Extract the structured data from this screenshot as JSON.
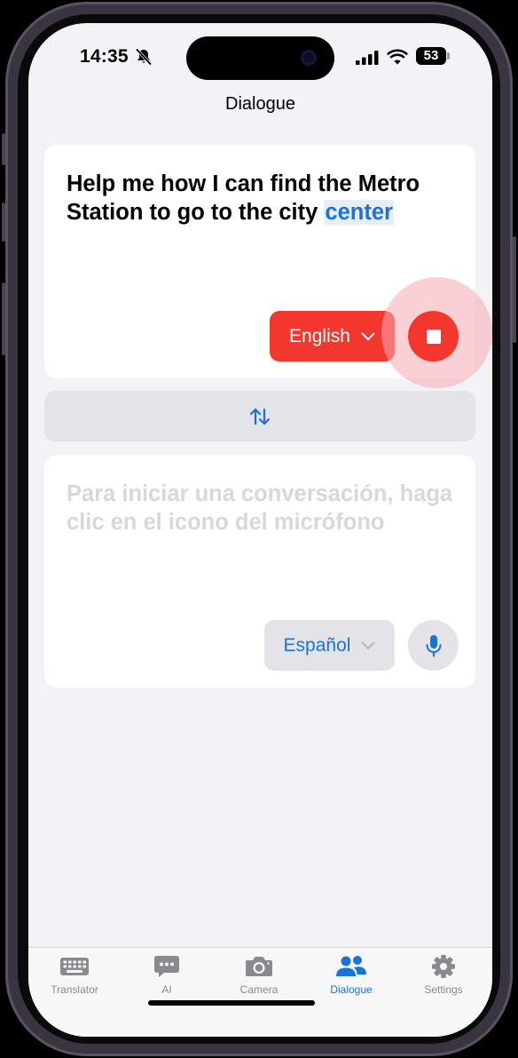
{
  "status_bar": {
    "time": "14:35",
    "battery": "53",
    "icons": [
      "bell-slash-icon",
      "cellular-signal-icon",
      "wifi-icon",
      "battery-icon"
    ]
  },
  "header": {
    "title": "Dialogue"
  },
  "source_card": {
    "text_main": "Help me how I can find the Metro Station to go to the city ",
    "text_highlight": "center",
    "language": "English",
    "record_state": "recording"
  },
  "swap": {
    "icon": "swap-arrows-icon"
  },
  "target_card": {
    "placeholder": "Para iniciar una conversación, haga clic en el icono del micrófono",
    "language": "Español"
  },
  "tabs": [
    {
      "label": "Translator",
      "icon": "keyboard-icon",
      "active": false
    },
    {
      "label": "AI",
      "icon": "chat-bubble-icon",
      "active": false
    },
    {
      "label": "Camera",
      "icon": "camera-icon",
      "active": false
    },
    {
      "label": "Dialogue",
      "icon": "people-icon",
      "active": true
    },
    {
      "label": "Settings",
      "icon": "gear-icon",
      "active": false
    }
  ],
  "colors": {
    "accent_blue": "#1a73d9",
    "record_red": "#f3372f",
    "background": "#f2f2f7",
    "placeholder_gray": "#d7d7dc"
  }
}
